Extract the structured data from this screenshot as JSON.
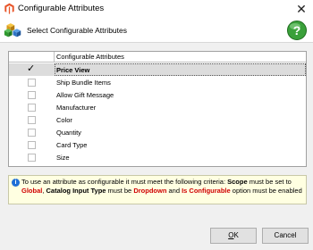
{
  "window": {
    "title": "Configurable Attributes",
    "close_symbol": "✕"
  },
  "header": {
    "text": "Select Configurable Attributes"
  },
  "grid": {
    "column_header": "Configurable Attributes",
    "rows": [
      {
        "label": "Price View",
        "checked": true,
        "selected": true
      },
      {
        "label": "Ship Bundle Items",
        "checked": false,
        "selected": false
      },
      {
        "label": "Allow Gift Message",
        "checked": false,
        "selected": false
      },
      {
        "label": "Manufacturer",
        "checked": false,
        "selected": false
      },
      {
        "label": "Color",
        "checked": false,
        "selected": false
      },
      {
        "label": "Quantity",
        "checked": false,
        "selected": false
      },
      {
        "label": "Card Type",
        "checked": false,
        "selected": false
      },
      {
        "label": "Size",
        "checked": false,
        "selected": false
      }
    ],
    "check_symbol": "✓"
  },
  "info": {
    "p1": "To use an attribute as configurable it must meet the following criteria: ",
    "scope": "Scope",
    "p2": " must be set to ",
    "global": "Global",
    "p3": ", ",
    "catalog_input_type": "Catalog Input Type",
    "p4": " must be ",
    "dropdown": "Dropdown",
    "p5": " and ",
    "is_configurable": "Is Configurable",
    "p6": " option must be enabled",
    "icon_glyph": "i"
  },
  "buttons": {
    "ok_mnemonic": "O",
    "ok_rest": "K",
    "cancel": "Cancel"
  },
  "icons": {
    "app": "magento-logo-icon",
    "header": "cubes-icon",
    "help": "help-icon",
    "info": "info-icon"
  }
}
